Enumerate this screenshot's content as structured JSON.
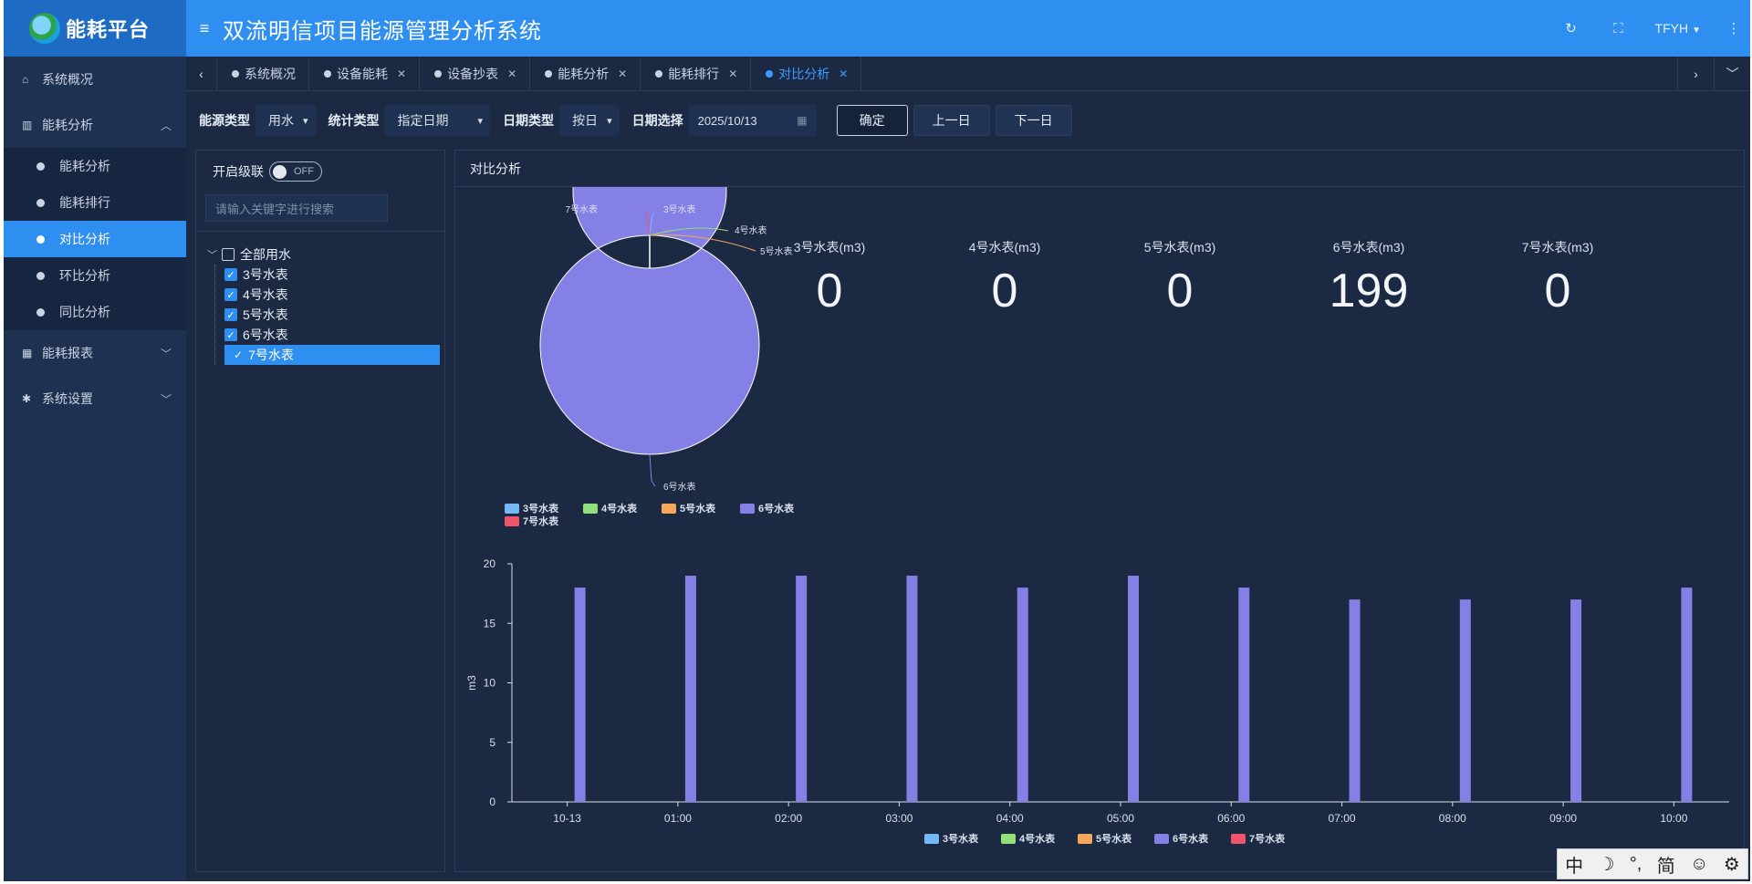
{
  "brand": {
    "name": "能耗平台"
  },
  "header": {
    "title": "双流明信项目能源管理分析系统",
    "user": "TFYH"
  },
  "sidebar": {
    "items": [
      {
        "label": "系统概况"
      },
      {
        "label": "能耗分析"
      },
      {
        "label": "能耗报表"
      },
      {
        "label": "系统设置"
      }
    ],
    "sub": [
      {
        "label": "能耗分析"
      },
      {
        "label": "能耗排行"
      },
      {
        "label": "对比分析"
      },
      {
        "label": "环比分析"
      },
      {
        "label": "同比分析"
      }
    ]
  },
  "tabs": [
    {
      "label": "系统概况"
    },
    {
      "label": "设备能耗"
    },
    {
      "label": "设备抄表"
    },
    {
      "label": "能耗分析"
    },
    {
      "label": "能耗排行"
    },
    {
      "label": "对比分析"
    }
  ],
  "filters": {
    "energy_type_label": "能源类型",
    "energy_type_value": "用水",
    "stat_type_label": "统计类型",
    "stat_type_value": "指定日期",
    "date_type_label": "日期类型",
    "date_type_value": "按日",
    "date_select_label": "日期选择",
    "date_value": "2025/10/13",
    "confirm": "确定",
    "prev_day": "上一日",
    "next_day": "下一日"
  },
  "tree": {
    "cascade_label": "开启级联",
    "switch_text": "OFF",
    "search_placeholder": "请输入关键字进行搜索",
    "root": "全部用水",
    "nodes": [
      {
        "label": "3号水表",
        "checked": true
      },
      {
        "label": "4号水表",
        "checked": true
      },
      {
        "label": "5号水表",
        "checked": true
      },
      {
        "label": "6号水表",
        "checked": true
      },
      {
        "label": "7号水表",
        "checked": true
      }
    ]
  },
  "panel": {
    "title": "对比分析"
  },
  "stats": [
    {
      "label": "3号水表(m3)",
      "value": "0"
    },
    {
      "label": "4号水表(m3)",
      "value": "0"
    },
    {
      "label": "5号水表(m3)",
      "value": "0"
    },
    {
      "label": "6号水表(m3)",
      "value": "199"
    },
    {
      "label": "7号水表(m3)",
      "value": "0"
    }
  ],
  "colors": {
    "meter3": "#73b9f7",
    "meter4": "#91e07a",
    "meter5": "#f7a65a",
    "meter6": "#8580e6",
    "meter7": "#f0546c"
  },
  "ime": {
    "chars": [
      "中",
      "☽",
      "°,",
      "简",
      "☺",
      "⚙"
    ]
  },
  "chart_data": [
    {
      "type": "pie",
      "labels": [
        "3号水表",
        "4号水表",
        "5号水表",
        "6号水表",
        "7号水表"
      ],
      "values": [
        0,
        0,
        0,
        199,
        0
      ],
      "legend": "top-left below chart"
    },
    {
      "type": "bar",
      "categories": [
        "10-13",
        "01:00",
        "02:00",
        "03:00",
        "04:00",
        "05:00",
        "06:00",
        "07:00",
        "08:00",
        "09:00",
        "10:00"
      ],
      "series": [
        {
          "name": "3号水表",
          "values": [
            0,
            0,
            0,
            0,
            0,
            0,
            0,
            0,
            0,
            0,
            0
          ]
        },
        {
          "name": "4号水表",
          "values": [
            0,
            0,
            0,
            0,
            0,
            0,
            0,
            0,
            0,
            0,
            0
          ]
        },
        {
          "name": "5号水表",
          "values": [
            0,
            0,
            0,
            0,
            0,
            0,
            0,
            0,
            0,
            0,
            0
          ]
        },
        {
          "name": "6号水表",
          "values": [
            18,
            19,
            19,
            19,
            18,
            19,
            18,
            17,
            17,
            17,
            18
          ]
        },
        {
          "name": "7号水表",
          "values": [
            0,
            0,
            0,
            0,
            0,
            0,
            0,
            0,
            0,
            0,
            0
          ]
        }
      ],
      "ylabel": "m3",
      "ylim": [
        0,
        20
      ],
      "yticks": [
        0,
        5,
        10,
        15,
        20
      ],
      "legend": "bottom"
    }
  ]
}
